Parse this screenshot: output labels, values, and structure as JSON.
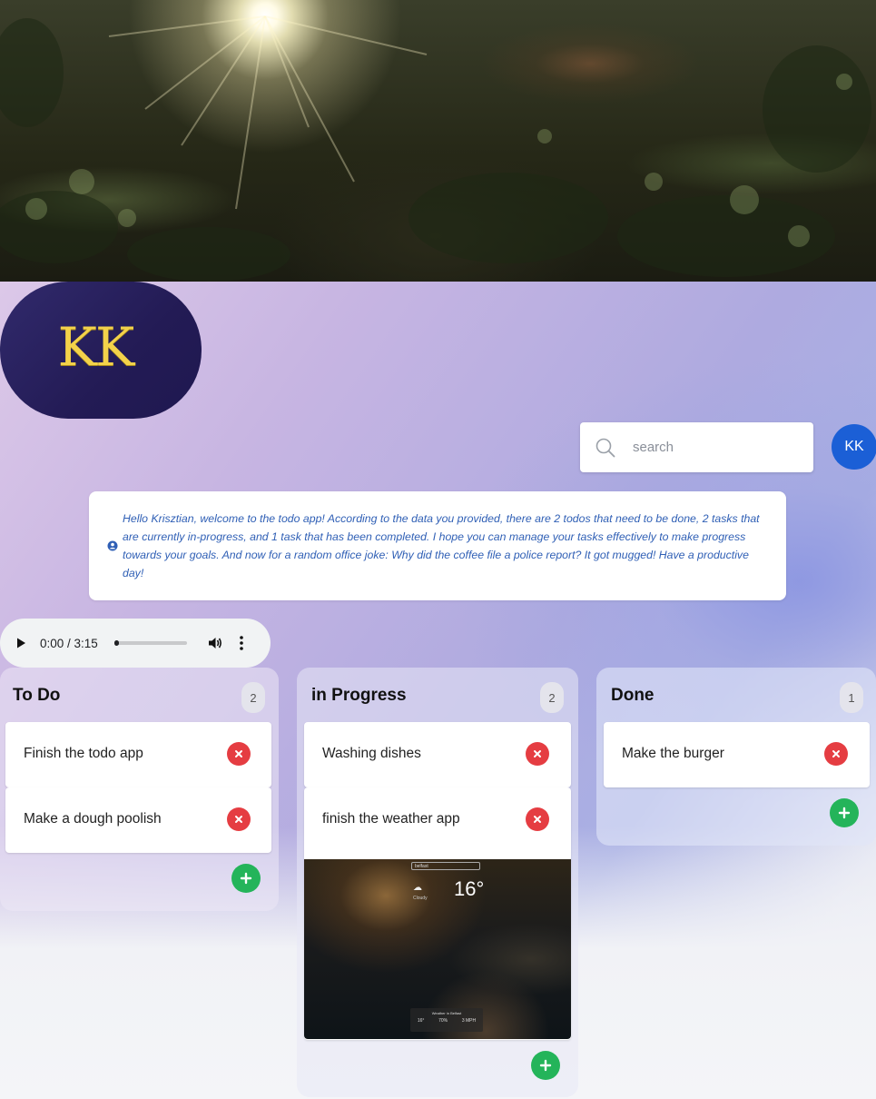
{
  "logo": {
    "text": "KK"
  },
  "search": {
    "placeholder": "search"
  },
  "user": {
    "initials": "KK"
  },
  "welcome": {
    "message": "Hello Krisztian, welcome to the todo app! According to the data you provided, there are 2 todos that need to be done, 2 tasks that are currently in-progress, and 1 task that has been completed. I hope you can manage your tasks effectively to make progress towards your goals. And now for a random office joke: Why did the coffee file a police report? It got mugged! Have a productive day!"
  },
  "audio": {
    "time": "0:00 / 3:15",
    "progress": 0
  },
  "columns": [
    {
      "title": "To Do",
      "count": "2",
      "tasks": [
        {
          "label": "Finish the todo app"
        },
        {
          "label": "Make a dough poolish"
        }
      ]
    },
    {
      "title": "in Progress",
      "count": "2",
      "tasks": [
        {
          "label": "Washing dishes"
        },
        {
          "label": "finish the weather app"
        }
      ],
      "attachment": {
        "search_text": "belfast",
        "temperature": "16°",
        "condition": "Cloudy",
        "panel_title": "Weather in Belfast",
        "stats": [
          "16°",
          "70%",
          "3 MPH"
        ]
      }
    },
    {
      "title": "Done",
      "count": "1",
      "tasks": [
        {
          "label": "Make the burger"
        }
      ]
    }
  ],
  "colors": {
    "accent_blue": "#1b5fd6",
    "delete_red": "#e53d42",
    "add_green": "#24b45a",
    "logo_gold": "#f3d24a",
    "logo_bg": "#231b55",
    "welcome_text": "#2f5fb5"
  },
  "icons": {
    "search": "search-icon",
    "info": "user-circle-icon",
    "delete": "close-icon",
    "add": "plus-icon",
    "play": "play-icon",
    "volume": "volume-icon",
    "more": "more-vertical-icon"
  }
}
